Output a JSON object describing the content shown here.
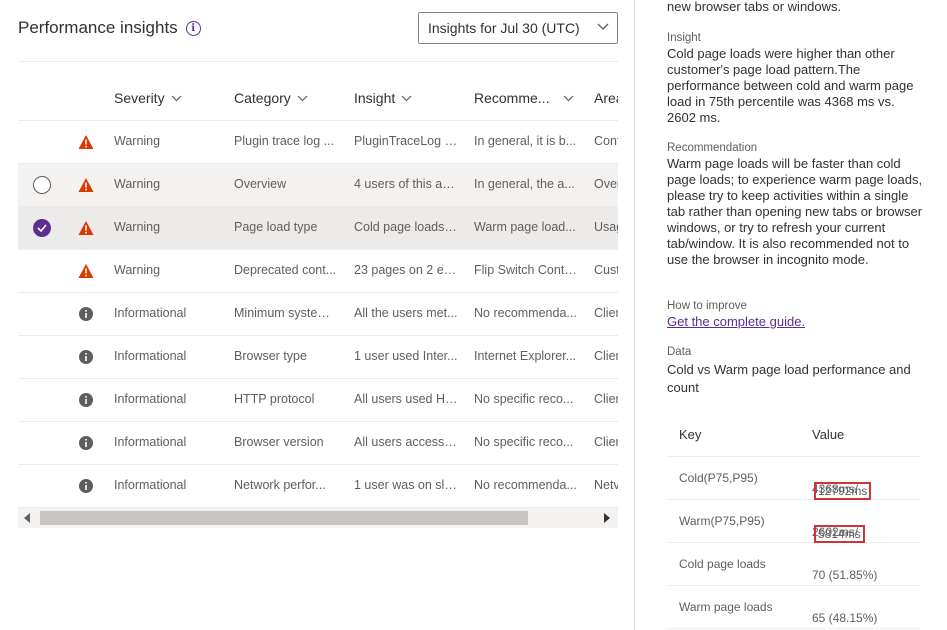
{
  "header": {
    "title": "Performance insights",
    "dropdown_value": "Insights for Jul 30 (UTC)"
  },
  "columns": [
    "Severity",
    "Category",
    "Insight",
    "Recomme...",
    "Area"
  ],
  "rows": [
    {
      "severity": "Warning",
      "category": "Plugin trace log ...",
      "insight": "PluginTraceLog s...",
      "recommendation": "In general, it is b...",
      "area": "Conf",
      "state": "none"
    },
    {
      "severity": "Warning",
      "category": "Overview",
      "insight": "4 users of this ap...",
      "recommendation": "In general, the a...",
      "area": "Over",
      "state": "hover"
    },
    {
      "severity": "Warning",
      "category": "Page load type",
      "insight": "Cold page loads ...",
      "recommendation": "Warm page load...",
      "area": "Usag",
      "state": "selected"
    },
    {
      "severity": "Warning",
      "category": "Deprecated cont...",
      "insight": "23 pages on 2 en...",
      "recommendation": "Flip Switch Contr...",
      "area": "Cust",
      "state": "none"
    },
    {
      "severity": "Informational",
      "category": "Minimum system...",
      "insight": "All the users met...",
      "recommendation": "No recommenda...",
      "area": "Clier",
      "state": "none"
    },
    {
      "severity": "Informational",
      "category": "Browser type",
      "insight": "1 user used Inter...",
      "recommendation": "Internet Explorer...",
      "area": "Clier",
      "state": "none"
    },
    {
      "severity": "Informational",
      "category": "HTTP protocol",
      "insight": "All users used HT...",
      "recommendation": "No specific reco...",
      "area": "Clier",
      "state": "none"
    },
    {
      "severity": "Informational",
      "category": "Browser version",
      "insight": "All users accesse...",
      "recommendation": "No specific reco...",
      "area": "Clier",
      "state": "none"
    },
    {
      "severity": "Informational",
      "category": "Network perfor...",
      "insight": "1 user was on slo...",
      "recommendation": "No recommenda...",
      "area": "Netv",
      "state": "none"
    }
  ],
  "panel": {
    "top_text": "new browser tabs or windows.",
    "insight_label": "Insight",
    "insight_text": "Cold page loads were higher than other customer's page load pattern.The performance between cold and warm page load in 75th percentile was 4368 ms vs. 2602 ms.",
    "recommendation_label": "Recommendation",
    "recommendation_text": "Warm page loads will be faster than cold page loads; to experience warm page loads, please try to keep activities within a single tab rather than opening new tabs or browser windows, or try to refresh your current tab/window. It is also recommended not to use the browser in incognito mode.",
    "improve_label": "How to improve",
    "improve_link": "Get the complete guide.",
    "data_label": "Data",
    "data_title": "Cold vs Warm page load performance and count",
    "table_headers": {
      "key": "Key",
      "value": "Value"
    },
    "table_rows": [
      {
        "key": "Cold(P75,P95)",
        "value_a": "4368ms/",
        "value_b": "12792ms"
      },
      {
        "key": "Warm(P75,P95)",
        "value_a": "2602ms/",
        "value_b": "5814ms"
      },
      {
        "key": "Cold page loads",
        "value_a": "70 (51.85%)",
        "value_b": ""
      },
      {
        "key": "Warm page loads",
        "value_a": "65 (48.15%)",
        "value_b": ""
      }
    ]
  },
  "colors": {
    "accent": "#5c2e91",
    "warning": "#d83b01",
    "info": "#605e5c",
    "highlight_box": "#d13438"
  },
  "icons": {
    "warning": "warning-triangle-icon",
    "info": "info-circle-icon",
    "check": "checkmark-icon",
    "chevron": "chevron-down-icon"
  }
}
